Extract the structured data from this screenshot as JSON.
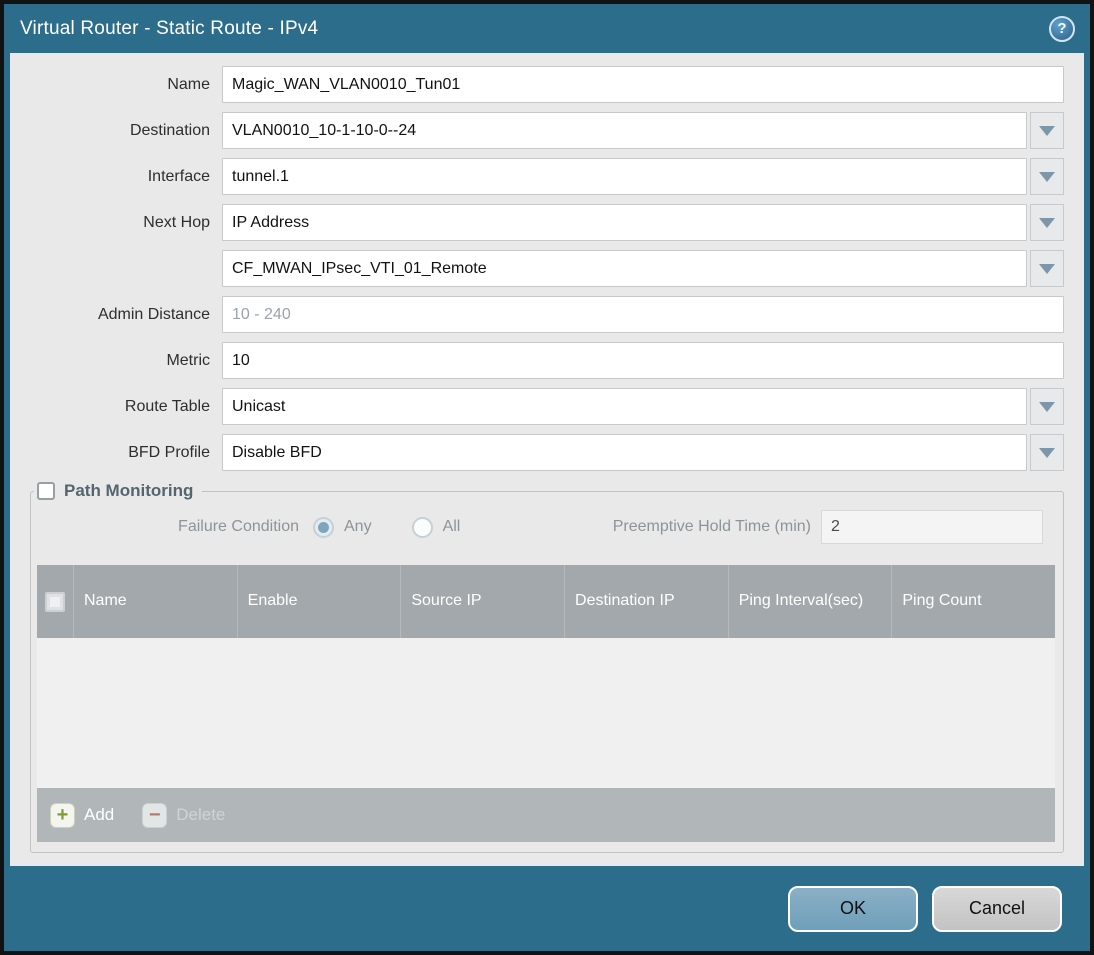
{
  "dialog": {
    "title": "Virtual Router - Static Route - IPv4",
    "help_icon": "?"
  },
  "form": {
    "name": {
      "label": "Name",
      "value": "Magic_WAN_VLAN0010_Tun01"
    },
    "destination": {
      "label": "Destination",
      "value": "VLAN0010_10-1-10-0--24"
    },
    "interface": {
      "label": "Interface",
      "value": "tunnel.1"
    },
    "next_hop": {
      "label": "Next Hop",
      "value": "IP Address"
    },
    "next_hop_address": {
      "value": "CF_MWAN_IPsec_VTI_01_Remote"
    },
    "admin_distance": {
      "label": "Admin Distance",
      "placeholder": "10 - 240",
      "value": ""
    },
    "metric": {
      "label": "Metric",
      "value": "10"
    },
    "route_table": {
      "label": "Route Table",
      "value": "Unicast"
    },
    "bfd_profile": {
      "label": "BFD Profile",
      "value": "Disable BFD"
    }
  },
  "path_monitoring": {
    "title": "Path Monitoring",
    "enabled": false,
    "failure_condition": {
      "label": "Failure Condition",
      "options": [
        "Any",
        "All"
      ],
      "selected": "Any"
    },
    "preemptive_hold_time": {
      "label": "Preemptive Hold Time (min)",
      "value": "2"
    },
    "table": {
      "columns": [
        "Name",
        "Enable",
        "Source IP",
        "Destination IP",
        "Ping Interval(sec)",
        "Ping Count"
      ],
      "rows": []
    },
    "add_label": "Add",
    "delete_label": "Delete",
    "add_icon": "+",
    "delete_icon": "−"
  },
  "footer": {
    "ok_label": "OK",
    "cancel_label": "Cancel"
  },
  "colors": {
    "titlebar_teal": "#2d6d8c",
    "content_gray": "#e9e9e9",
    "table_header_gray": "#a3a8ac",
    "table_footer_gray": "#b1b6b9",
    "ok_button_blue": "#79a7c0",
    "cancel_button_gray": "#c9c9c9",
    "add_icon_green": "#7f9c33",
    "delete_icon_red": "#b5796c",
    "dropdown_arrow": "#7d96aa"
  }
}
